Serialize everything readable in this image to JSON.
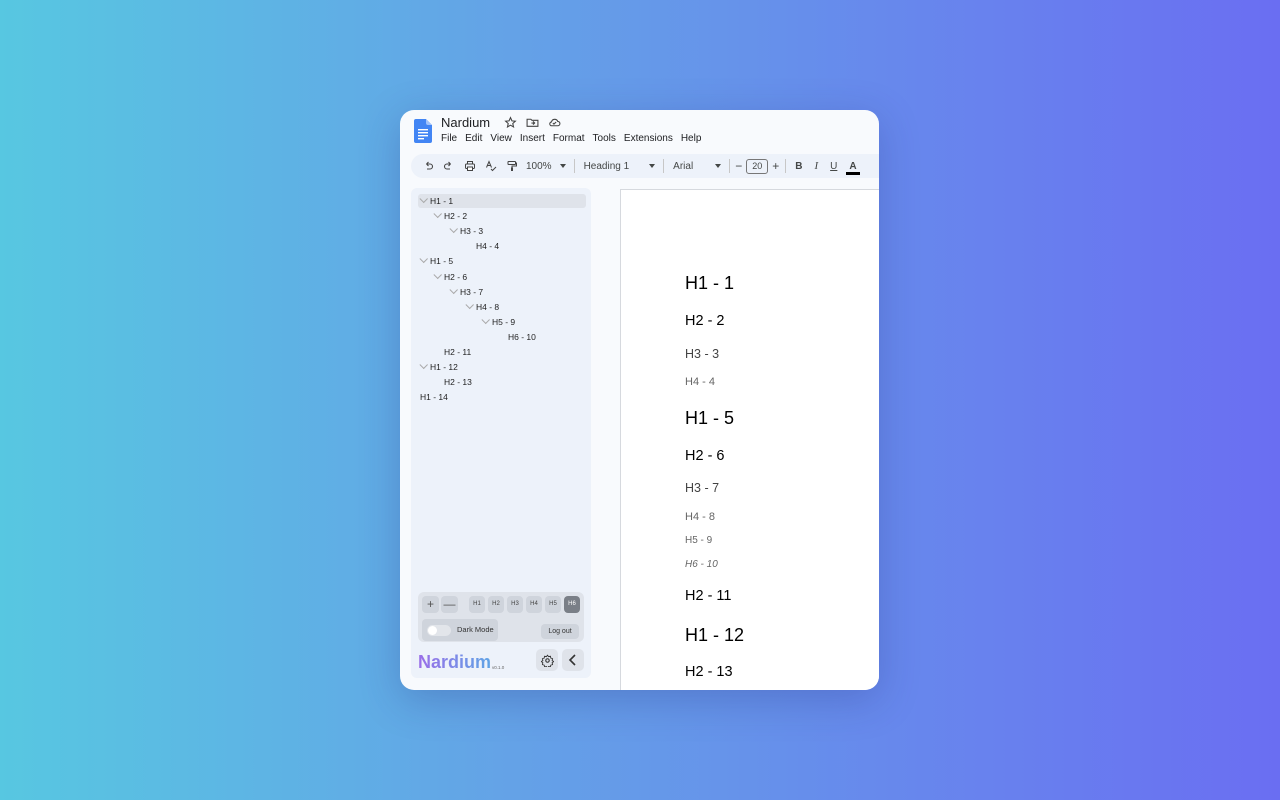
{
  "doc": {
    "title": "Nardium",
    "menu": [
      "File",
      "Edit",
      "View",
      "Insert",
      "Format",
      "Tools",
      "Extensions",
      "Help"
    ]
  },
  "toolbar": {
    "zoom": "100%",
    "style": "Heading 1",
    "font": "Arial",
    "font_size": "20",
    "bold": "B",
    "italic": "I",
    "underline": "U",
    "text_color": "A"
  },
  "outline": {
    "items": [
      {
        "label": "H1 - 1",
        "level": 1,
        "chevron": true,
        "active": true
      },
      {
        "label": "H2 - 2",
        "level": 2,
        "chevron": true
      },
      {
        "label": "H3 - 3",
        "level": 3,
        "chevron": true
      },
      {
        "label": "H4 - 4",
        "level": 4,
        "chevron": false
      },
      {
        "label": "H1 - 5",
        "level": 1,
        "chevron": true
      },
      {
        "label": "H2 - 6",
        "level": 2,
        "chevron": true
      },
      {
        "label": "H3 - 7",
        "level": 3,
        "chevron": true
      },
      {
        "label": "H4 - 8",
        "level": 4,
        "chevron": true
      },
      {
        "label": "H5 - 9",
        "level": 5,
        "chevron": true
      },
      {
        "label": "H6 - 10",
        "level": 6,
        "chevron": false
      },
      {
        "label": "H2 - 11",
        "level": 2,
        "chevron": false
      },
      {
        "label": "H1 - 12",
        "level": 1,
        "chevron": true
      },
      {
        "label": "H2 - 13",
        "level": 2,
        "chevron": false
      },
      {
        "label": "H1 - 14",
        "level": 1,
        "chevron": false
      }
    ]
  },
  "controls": {
    "expand": "+",
    "collapse": "—",
    "levels": [
      "H1",
      "H2",
      "H3",
      "H4",
      "H5",
      "H6"
    ],
    "selected_level": "H6",
    "dark_mode_label": "Dark Mode",
    "dark_mode_on": false,
    "logout_label": "Log out"
  },
  "brand": {
    "name": "Nardium",
    "version": "v0.1.0"
  },
  "document_headings": [
    {
      "text": "H1 - 1",
      "level": 1
    },
    {
      "text": "H2 - 2",
      "level": 2
    },
    {
      "text": "H3 - 3",
      "level": 3
    },
    {
      "text": "H4 - 4",
      "level": 4
    },
    {
      "text": "H1 - 5",
      "level": 1
    },
    {
      "text": "H2 - 6",
      "level": 2
    },
    {
      "text": "H3 - 7",
      "level": 3
    },
    {
      "text": "H4 - 8",
      "level": 4
    },
    {
      "text": "H5 - 9",
      "level": 5
    },
    {
      "text": "H6 - 10",
      "level": 6
    },
    {
      "text": "H2 - 11",
      "level": 2
    },
    {
      "text": "H1 - 12",
      "level": 1
    },
    {
      "text": "H2 - 13",
      "level": 2
    }
  ]
}
